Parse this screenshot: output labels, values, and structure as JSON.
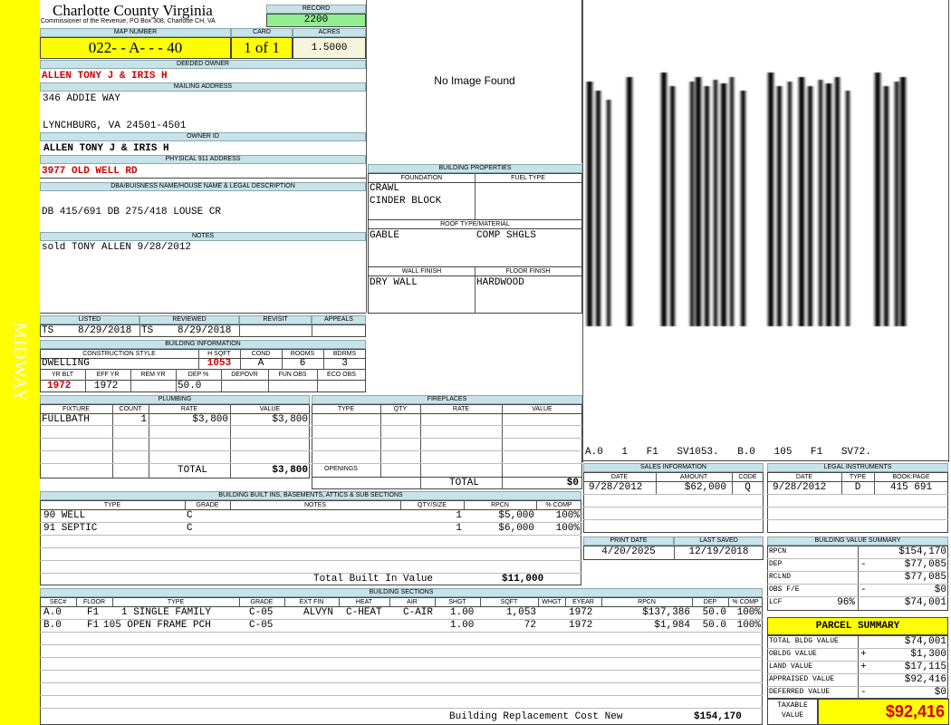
{
  "side_label": "MIDWAY",
  "header": {
    "county": "Charlotte County Virginia",
    "subtitle": "Commissioner of the Revenue, PO Box 308, Charlotte CH, VA",
    "record_label": "RECORD",
    "record_value": "2200"
  },
  "parcel": {
    "map_number_label": "MAP NUMBER",
    "map_number": "022- - A- - - 40",
    "card_label": "CARD",
    "card": "1 of 1",
    "acres_label": "ACRES",
    "acres": "1.5000"
  },
  "owner": {
    "deeded_label": "DEEDED OWNER",
    "deeded_owner": "ALLEN TONY J & IRIS H",
    "mailing_label": "MAILING ADDRESS",
    "mailing_line1": "346 ADDIE WAY",
    "mailing_line2": "LYNCHBURG, VA 24501-4501",
    "owner_id_label": "OWNER ID",
    "owner_id": "ALLEN TONY J & IRIS H",
    "physical_label": "PHYSICAL 911 ADDRESS",
    "physical_address": "3977 OLD WELL RD",
    "legal_label": "DBA/BUISNESS NAME/HOUSE NAME & LEGAL DESCRIPTION",
    "legal_desc": "DB 415/691 DB 275/418 LOUSE CR",
    "notes_label": "NOTES",
    "notes": "sold TONY ALLEN 9/28/2012"
  },
  "image_placeholder": "No Image Found",
  "building_properties": {
    "title": "BUILDING PROPERTIES",
    "foundation_label": "FOUNDATION",
    "foundation_1": "CRAWL",
    "foundation_2": "CINDER BLOCK",
    "fuel_label": "FUEL TYPE",
    "roof_label": "ROOF TYPE/MATERIAL",
    "roof_type": "GABLE",
    "roof_material": "COMP SHGLS",
    "wall_label": "WALL FINISH",
    "wall": "DRY WALL",
    "floor_label": "FLOOR FINISH",
    "floor": "HARDWOOD"
  },
  "sketch_caption": "A.0 1 F1 SV1053. B.0 105 F1 SV72.",
  "listing": {
    "listed_label": "LISTED",
    "listed_by": "TS",
    "listed_date": "8/29/2018",
    "reviewed_label": "REVIEWED",
    "reviewed_by": "TS",
    "reviewed_date": "8/29/2018",
    "revisit_label": "REVISIT",
    "appeals_label": "APPEALS"
  },
  "building_info": {
    "title": "BUILDING INFORMATION",
    "style_label": "CONSTRUCTION STYLE",
    "style": "DWELLING",
    "hsqft_label": "H SQFT",
    "hsqft": "1053",
    "cond_label": "COND",
    "cond": "A",
    "rooms_label": "ROOMS",
    "rooms": "6",
    "bdrms_label": "BDRMS",
    "bdrms": "3",
    "yrblt_label": "YR BLT",
    "yrblt": "1972",
    "effyr_label": "EFF YR",
    "effyr": "1972",
    "remyr_label": "REM YR",
    "dep_label": "DEP %",
    "dep": "50.0",
    "depovr_label": "DEPOVR",
    "funobs_label": "FUN OBS",
    "ecoobs_label": "ECO OBS"
  },
  "plumbing": {
    "title": "PLUMBING",
    "cols": [
      "FIXTURE",
      "COUNT",
      "RATE",
      "VALUE"
    ],
    "fixture": "FULLBATH",
    "count": "1",
    "rate": "$3,800",
    "value": "$3,800",
    "total_label": "TOTAL",
    "total": "$3,800"
  },
  "fireplaces": {
    "title": "FIREPLACES",
    "cols": [
      "TYPE",
      "QTY",
      "RATE",
      "VALUE"
    ],
    "openings_label": "OPENINGS",
    "total_label": "TOTAL",
    "total": "$0"
  },
  "sales": {
    "title": "SALES INFORMATION",
    "cols": [
      "DATE",
      "AMOUNT",
      "CODE"
    ],
    "date": "9/28/2012",
    "amount": "$62,000",
    "code": "Q"
  },
  "legal_instruments": {
    "title": "LEGAL INSTRUMENTS",
    "cols": [
      "DATE",
      "TYPE",
      "BOOK:PAGE"
    ],
    "date": "9/28/2012",
    "type": "D",
    "bookpage": "415 691"
  },
  "print_info": {
    "print_label": "PRINT DATE",
    "print_date": "4/20/2025",
    "saved_label": "LAST SAVED",
    "saved_date": "12/19/2018"
  },
  "builtins": {
    "title": "BUILDING BUILT INS, BASEMENTS, ATTICS & SUB SECTIONS",
    "cols": [
      "TYPE",
      "GRADE",
      "NOTES",
      "QTY/SIZE",
      "RPCN",
      "% COMP"
    ],
    "rows": [
      {
        "type": "90 WELL",
        "grade": "C",
        "qty": "1",
        "rpcn": "$5,000",
        "comp": "100%"
      },
      {
        "type": "91 SEPTIC",
        "grade": "C",
        "qty": "1",
        "rpcn": "$6,000",
        "comp": "100%"
      }
    ],
    "total_label": "Total Built In Value",
    "total": "$11,000"
  },
  "value_summary": {
    "title": "BUILDING VALUE SUMMARY",
    "rpcn_label": "RPCN",
    "rpcn": "$154,170",
    "dep_label": "DEP",
    "dep_sign": "-",
    "dep": "$77,085",
    "rclnd_label": "RCLND",
    "rclnd": "$77,085",
    "obs_label": "OBS F/E",
    "obs_sign": "-",
    "obs": "$0",
    "lcf_label": "LCF",
    "lcf_pct": "96%",
    "lcf": "$74,001"
  },
  "sections": {
    "title": "BUILDING SECTIONS",
    "cols": [
      "SEC#",
      "FLOOR",
      "TYPE",
      "GRADE",
      "EXT FIN",
      "HEAT",
      "AIR",
      "SHGT",
      "SQFT",
      "WHGT",
      "EYEAR",
      "RPCN",
      "DEP",
      "% COMP"
    ],
    "rows": [
      {
        "sec": "A.0",
        "floor": "F1",
        "type": "1 SINGLE FAMILY",
        "grade": "C-05",
        "ext": "ALVYN",
        "heat": "C-HEAT",
        "air": "C-AIR",
        "shgt": "1.00",
        "sqft": "1,053",
        "whgt": "",
        "eyear": "1972",
        "rpcn": "$137,386",
        "dep": "50.0",
        "comp": "100%"
      },
      {
        "sec": "B.0",
        "floor": "F1",
        "type": "105 OPEN FRAME PCH",
        "grade": "C-05",
        "ext": "",
        "heat": "",
        "air": "",
        "shgt": "1.00",
        "sqft": "72",
        "whgt": "",
        "eyear": "1972",
        "rpcn": "$1,984",
        "dep": "50.0",
        "comp": "100%"
      }
    ],
    "total_label": "Building Replacement Cost New",
    "total": "$154,170"
  },
  "parcel_summary": {
    "title": "PARCEL SUMMARY",
    "rows": [
      {
        "label": "TOTAL BLDG VALUE",
        "sign": "",
        "value": "$74,001"
      },
      {
        "label": "OBLDG VALUE",
        "sign": "+",
        "value": "$1,300"
      },
      {
        "label": "LAND VALUE",
        "sign": "+",
        "value": "$17,115"
      },
      {
        "label": "APPRAISED VALUE",
        "sign": "",
        "value": "$92,416"
      },
      {
        "label": "DEFERRED VALUE",
        "sign": "-",
        "value": "$0"
      }
    ],
    "taxable_label_1": "TAXABLE",
    "taxable_label_2": "VALUE",
    "taxable": "$92,416"
  },
  "colors": {
    "yellow": "#ffff00",
    "header_blue": "#c8e2ea",
    "record_green": "#90ee90",
    "red": "#d00000"
  }
}
